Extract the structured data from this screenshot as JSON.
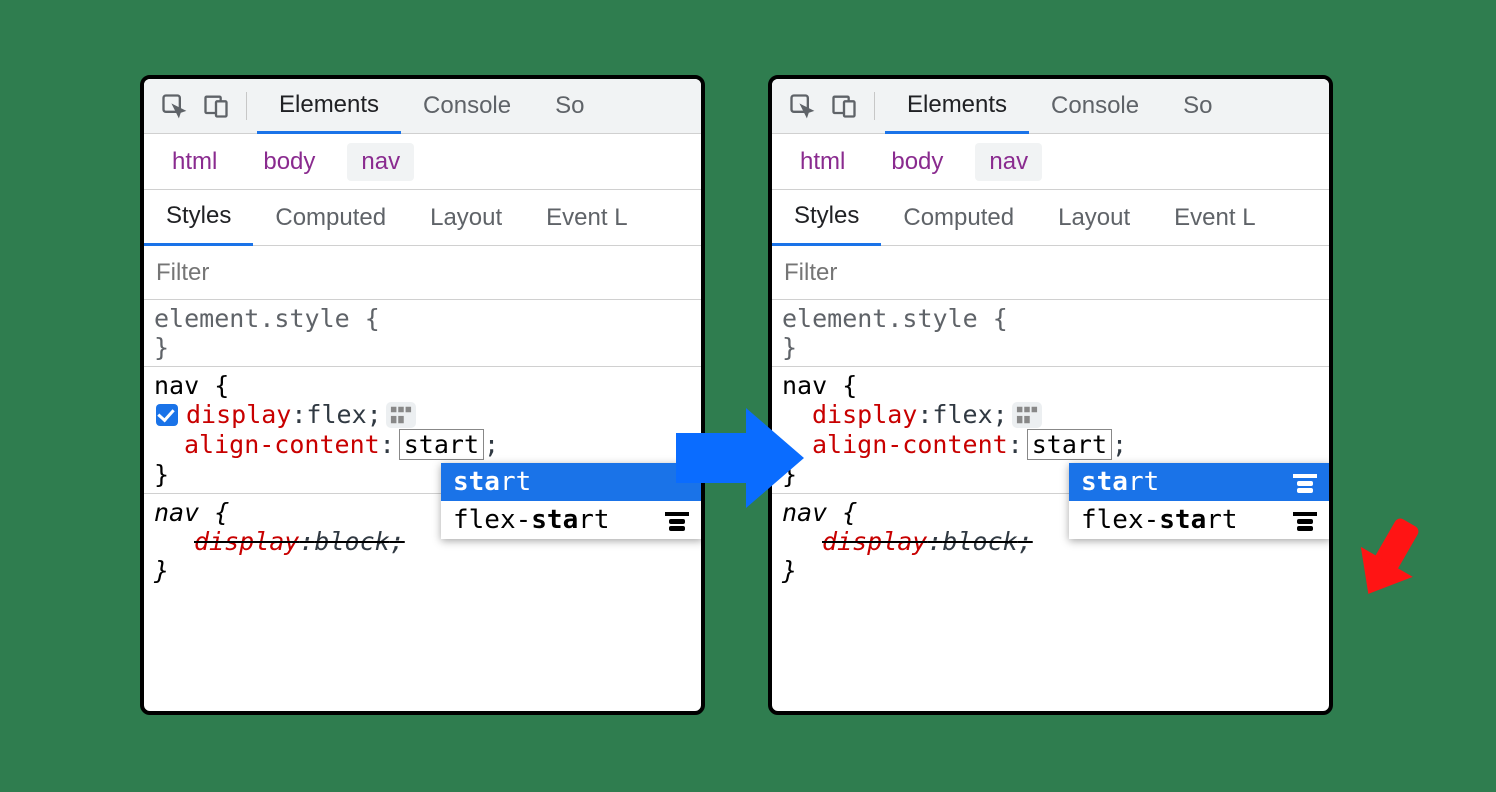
{
  "topTabs": {
    "t1": "Elements",
    "t2": "Console",
    "t3": "So"
  },
  "crumbs": {
    "c1": "html",
    "c2": "body",
    "c3": "nav"
  },
  "subTabs": {
    "s1": "Styles",
    "s2": "Computed",
    "s3": "Layout",
    "s4": "Event L"
  },
  "filter": {
    "placeholder": "Filter"
  },
  "rules": {
    "elstyle_open": "element.style {",
    "close": "}",
    "nav_open": "nav {",
    "display_prop": "display",
    "display_val": "flex",
    "align_prop": "align-content",
    "align_val": "start",
    "semi": ";",
    "colon": ": ",
    "nav_ua_open": "nav {",
    "ua_display_prop": "display",
    "ua_display_val": "block",
    "ua_close": "}"
  },
  "drop": {
    "opt1_bold": "sta",
    "opt1_rest": "rt",
    "opt2_pre": "flex-",
    "opt2_bold": "sta",
    "opt2_rest": "rt"
  }
}
